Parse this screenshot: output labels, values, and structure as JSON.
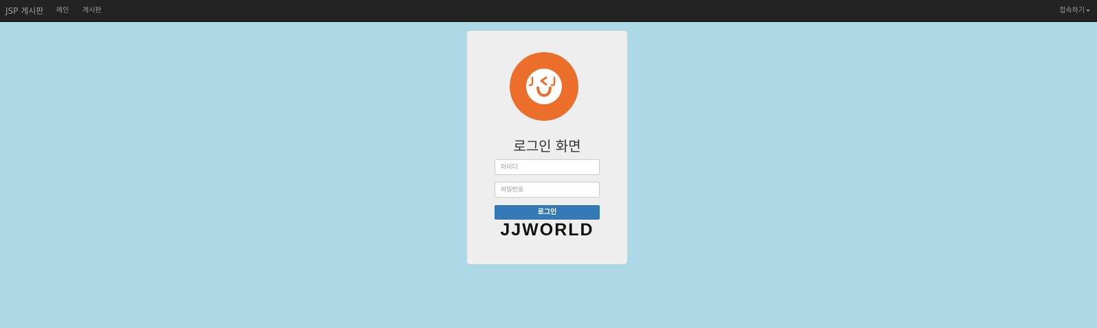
{
  "navbar": {
    "brand": "JSP 게시판",
    "items": [
      {
        "label": "메인"
      },
      {
        "label": "게시판"
      }
    ],
    "dropdown_label": "접속하기"
  },
  "login": {
    "title": "로그인 화면",
    "id_placeholder": "아이디",
    "password_placeholder": "비밀번호",
    "submit_label": "로그인",
    "logo_letters": "J < J",
    "wordmark": "JJWORLD"
  },
  "colors": {
    "page_background": "#add8e6",
    "navbar_background": "#222222",
    "card_background": "#eeeeee",
    "logo_orange": "#eb6e2a",
    "button_primary": "#337ab7"
  }
}
